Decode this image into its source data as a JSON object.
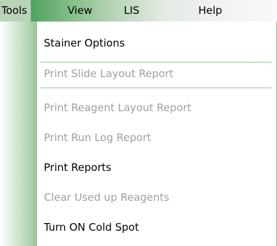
{
  "menubar": {
    "items": [
      {
        "label": "Tools"
      },
      {
        "label": "View"
      },
      {
        "label": "LIS"
      },
      {
        "label": "Help"
      }
    ]
  },
  "dropdown": {
    "items": [
      {
        "label": "Stainer Options",
        "enabled": true
      },
      {
        "label": "Print Slide Layout Report",
        "enabled": false
      },
      {
        "label": "Print Reagent Layout Report",
        "enabled": false
      },
      {
        "label": "Print Run Log Report",
        "enabled": false
      },
      {
        "label": "Print Reports",
        "enabled": true
      },
      {
        "label": "Clear Used up Reagents",
        "enabled": false
      },
      {
        "label": "Turn ON Cold Spot",
        "enabled": true
      }
    ]
  },
  "colors": {
    "menubar_accent": "#1a8a3e",
    "enabled_text": "#000000",
    "disabled_text": "#a0a0a0",
    "separator": "#9cc59c"
  }
}
